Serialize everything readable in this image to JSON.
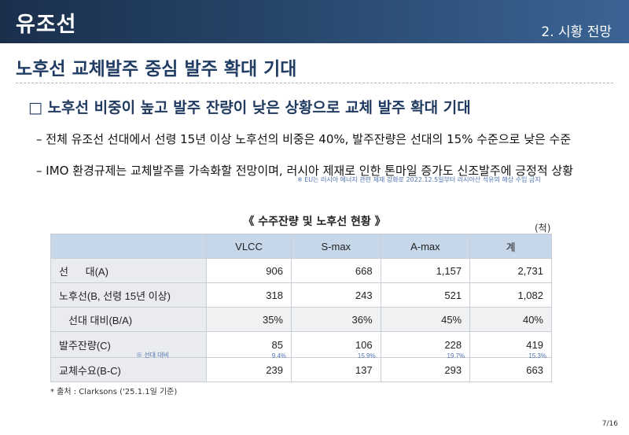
{
  "header": {
    "title": "유조선",
    "section": "2. 시황 전망"
  },
  "subtitle": "노후선 교체발주 중심 발주 확대 기대",
  "headline": "□ 노후선 비중이 높고 발주 잔량이 낮은 상황으로 교체 발주 확대 기대",
  "bullets": [
    "– 전체 유조선 선대에서 선령 15년 이상 노후선의 비중은 40%, 발주잔량은 선대의 15% 수준으로 낮은 수준",
    "– IMO 환경규제는 교체발주를 가속화할 전망이며, 러시아 제재로 인한 톤마일 증가도 신조발주에 긍정적 상황"
  ],
  "eu_note": "※ EU는 러시아 에너지 관련 제재 강화로 2022.12.5일부터 러시아산 석유의 해상 수입 금지",
  "table": {
    "title": "《 수주잔량 및 노후선 현황 》",
    "unit": "(척)",
    "columns": [
      "VLCC",
      "S-max",
      "A-max",
      "계"
    ],
    "rows": [
      {
        "label": "선      대(A)",
        "values": [
          "906",
          "668",
          "1,157",
          "2,731"
        ]
      },
      {
        "label": "노후선(B, 선령 15년 이상)",
        "values": [
          "318",
          "243",
          "521",
          "1,082"
        ]
      },
      {
        "label": "선대 대비(B/A)",
        "values": [
          "35%",
          "36%",
          "45%",
          "40%"
        ]
      },
      {
        "label": "발주잔량(C)",
        "values": [
          "85",
          "106",
          "228",
          "419"
        ],
        "ratio_label": "※ 선대 대비",
        "ratios": [
          "9.4%",
          "15.9%",
          "19.7%",
          "15.3%"
        ]
      },
      {
        "label": "교체수요(B-C)",
        "values": [
          "239",
          "137",
          "293",
          "663"
        ]
      }
    ]
  },
  "source": "* 출처 : Clarksons ('25.1.1일 기준)",
  "page": "7/16"
}
